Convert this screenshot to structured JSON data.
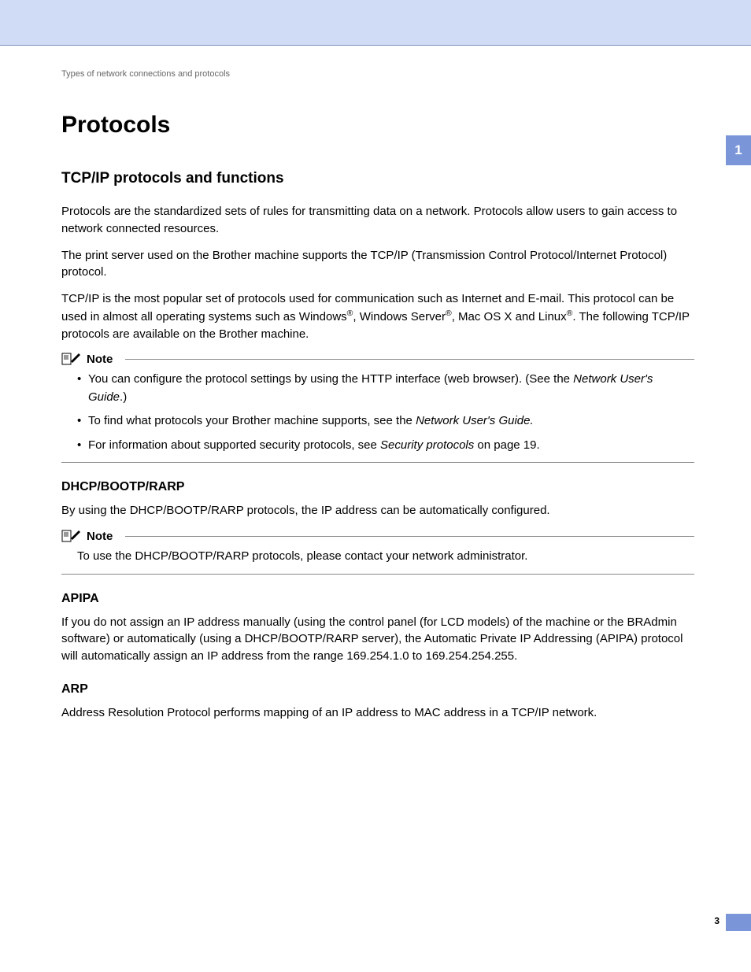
{
  "breadcrumb": "Types of network connections and protocols",
  "title": "Protocols",
  "chapter_tab": "1",
  "page_number": "3",
  "section1": {
    "heading": "TCP/IP protocols and functions",
    "p1": "Protocols are the standardized sets of rules for transmitting data on a network. Protocols allow users to gain access to network connected resources.",
    "p2": "The print server used on the Brother machine supports the TCP/IP (Transmission Control Protocol/Internet Protocol) protocol.",
    "p3a": "TCP/IP is the most popular set of protocols used for communication such as Internet and E-mail. This protocol can be used in almost all operating systems such as Windows",
    "p3b": ", Windows Server",
    "p3c": ", Mac OS X and Linux",
    "p3d": ". The following TCP/IP protocols are available on the Brother machine."
  },
  "note1": {
    "label": "Note",
    "b1a": "You can configure the protocol settings by using the HTTP interface (web browser). (See the ",
    "b1b": "Network User's Guide",
    "b1c": ".)",
    "b2a": "To find what protocols your Brother machine supports, see the ",
    "b2b": "Network User's Guide.",
    "b3a": "For information about supported security protocols, see ",
    "b3b": "Security protocols",
    "b3c": " on page 19."
  },
  "dhcp": {
    "heading": "DHCP/BOOTP/RARP",
    "p": "By using the DHCP/BOOTP/RARP protocols, the IP address can be automatically configured."
  },
  "note2": {
    "label": "Note",
    "p": "To use the DHCP/BOOTP/RARP protocols, please contact your network administrator."
  },
  "apipa": {
    "heading": "APIPA",
    "p": "If you do not assign an IP address manually (using the control panel (for LCD models) of the machine or the BRAdmin software) or automatically (using a DHCP/BOOTP/RARP server), the Automatic Private IP Addressing (APIPA) protocol will automatically assign an IP address from the range 169.254.1.0 to 169.254.254.255."
  },
  "arp": {
    "heading": "ARP",
    "p": "Address Resolution Protocol performs mapping of an IP address to MAC address in a TCP/IP network."
  }
}
